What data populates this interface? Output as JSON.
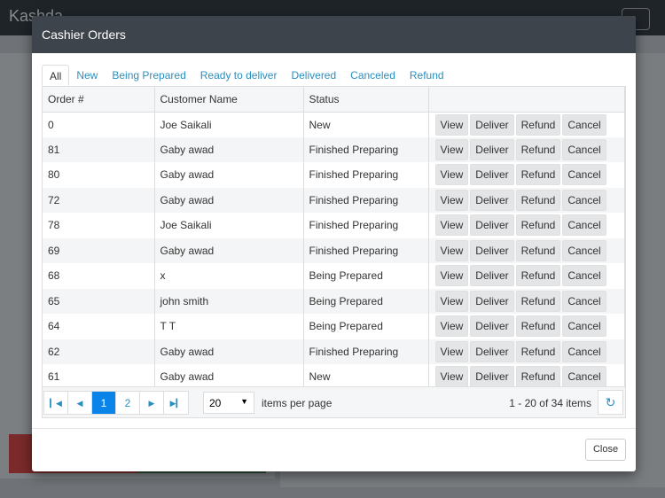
{
  "app": {
    "brand": "Kashda"
  },
  "modal": {
    "title": "Cashier Orders",
    "close_label": "Close"
  },
  "tabs": [
    "All",
    "New",
    "Being Prepared",
    "Ready to deliver",
    "Delivered",
    "Canceled",
    "Refund"
  ],
  "table": {
    "columns": [
      "Order #",
      "Customer Name",
      "Status",
      ""
    ],
    "actions": [
      "View",
      "Deliver",
      "Refund",
      "Cancel"
    ],
    "rows": [
      {
        "order": "0",
        "customer": "Joe Saikali",
        "status": "New"
      },
      {
        "order": "81",
        "customer": "Gaby awad",
        "status": "Finished Preparing"
      },
      {
        "order": "80",
        "customer": "Gaby awad",
        "status": "Finished Preparing"
      },
      {
        "order": "72",
        "customer": "Gaby awad",
        "status": "Finished Preparing"
      },
      {
        "order": "78",
        "customer": "Joe Saikali",
        "status": "Finished Preparing"
      },
      {
        "order": "69",
        "customer": "Gaby awad",
        "status": "Finished Preparing"
      },
      {
        "order": "68",
        "customer": "x",
        "status": "Being Prepared"
      },
      {
        "order": "65",
        "customer": "john smith",
        "status": "Being Prepared"
      },
      {
        "order": "64",
        "customer": "T T",
        "status": "Being Prepared"
      },
      {
        "order": "62",
        "customer": "Gaby awad",
        "status": "Finished Preparing"
      },
      {
        "order": "61",
        "customer": "Gaby awad",
        "status": "New"
      }
    ]
  },
  "pager": {
    "pages": [
      "1",
      "2"
    ],
    "current": "1",
    "page_size": "20",
    "items_per_page_label": "items per page",
    "info": "1 - 20 of 34 items"
  }
}
